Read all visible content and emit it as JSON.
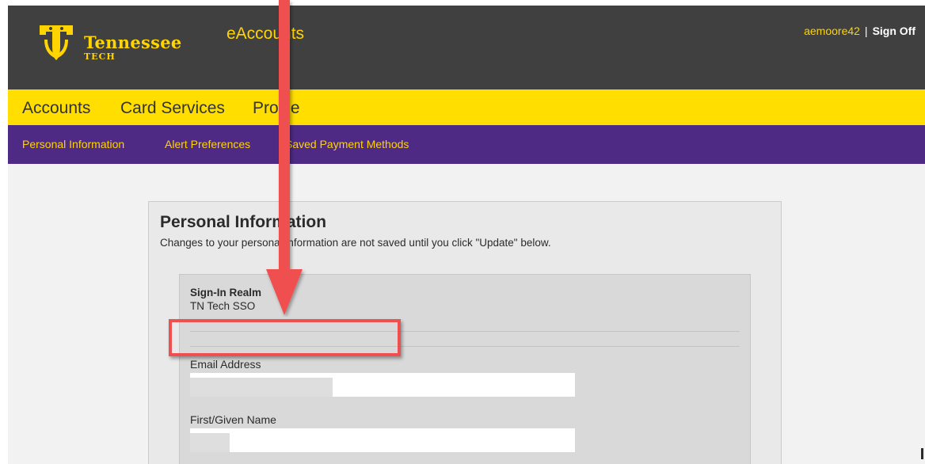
{
  "header": {
    "brand_name": "Tennessee",
    "brand_sub": "TECH",
    "app_title": "eAccounts",
    "username": "aemoore42",
    "separator": "|",
    "sign_off": "Sign Off"
  },
  "main_nav": {
    "items": [
      "Accounts",
      "Card Services",
      "Profile"
    ]
  },
  "sub_nav": {
    "items": [
      "Personal Information",
      "Alert Preferences",
      "Saved Payment Methods"
    ]
  },
  "panel": {
    "title": "Personal Information",
    "description": "Changes to your personal information are not saved until you click \"Update\" below.",
    "realm_label": "Sign-In Realm",
    "realm_value": "TN Tech SSO",
    "email_label": "Email Address",
    "email_value": "",
    "first_name_label": "First/Given Name",
    "first_name_value": ""
  },
  "colors": {
    "header_bg": "#404040",
    "brand_yellow": "#ffd400",
    "nav_yellow": "#ffde00",
    "nav_purple": "#4e2a84",
    "annotation_red": "#f04f4f"
  },
  "icons": {
    "logo": "tennessee-tech-logo-icon",
    "arrow": "red-down-arrow-annotation"
  }
}
